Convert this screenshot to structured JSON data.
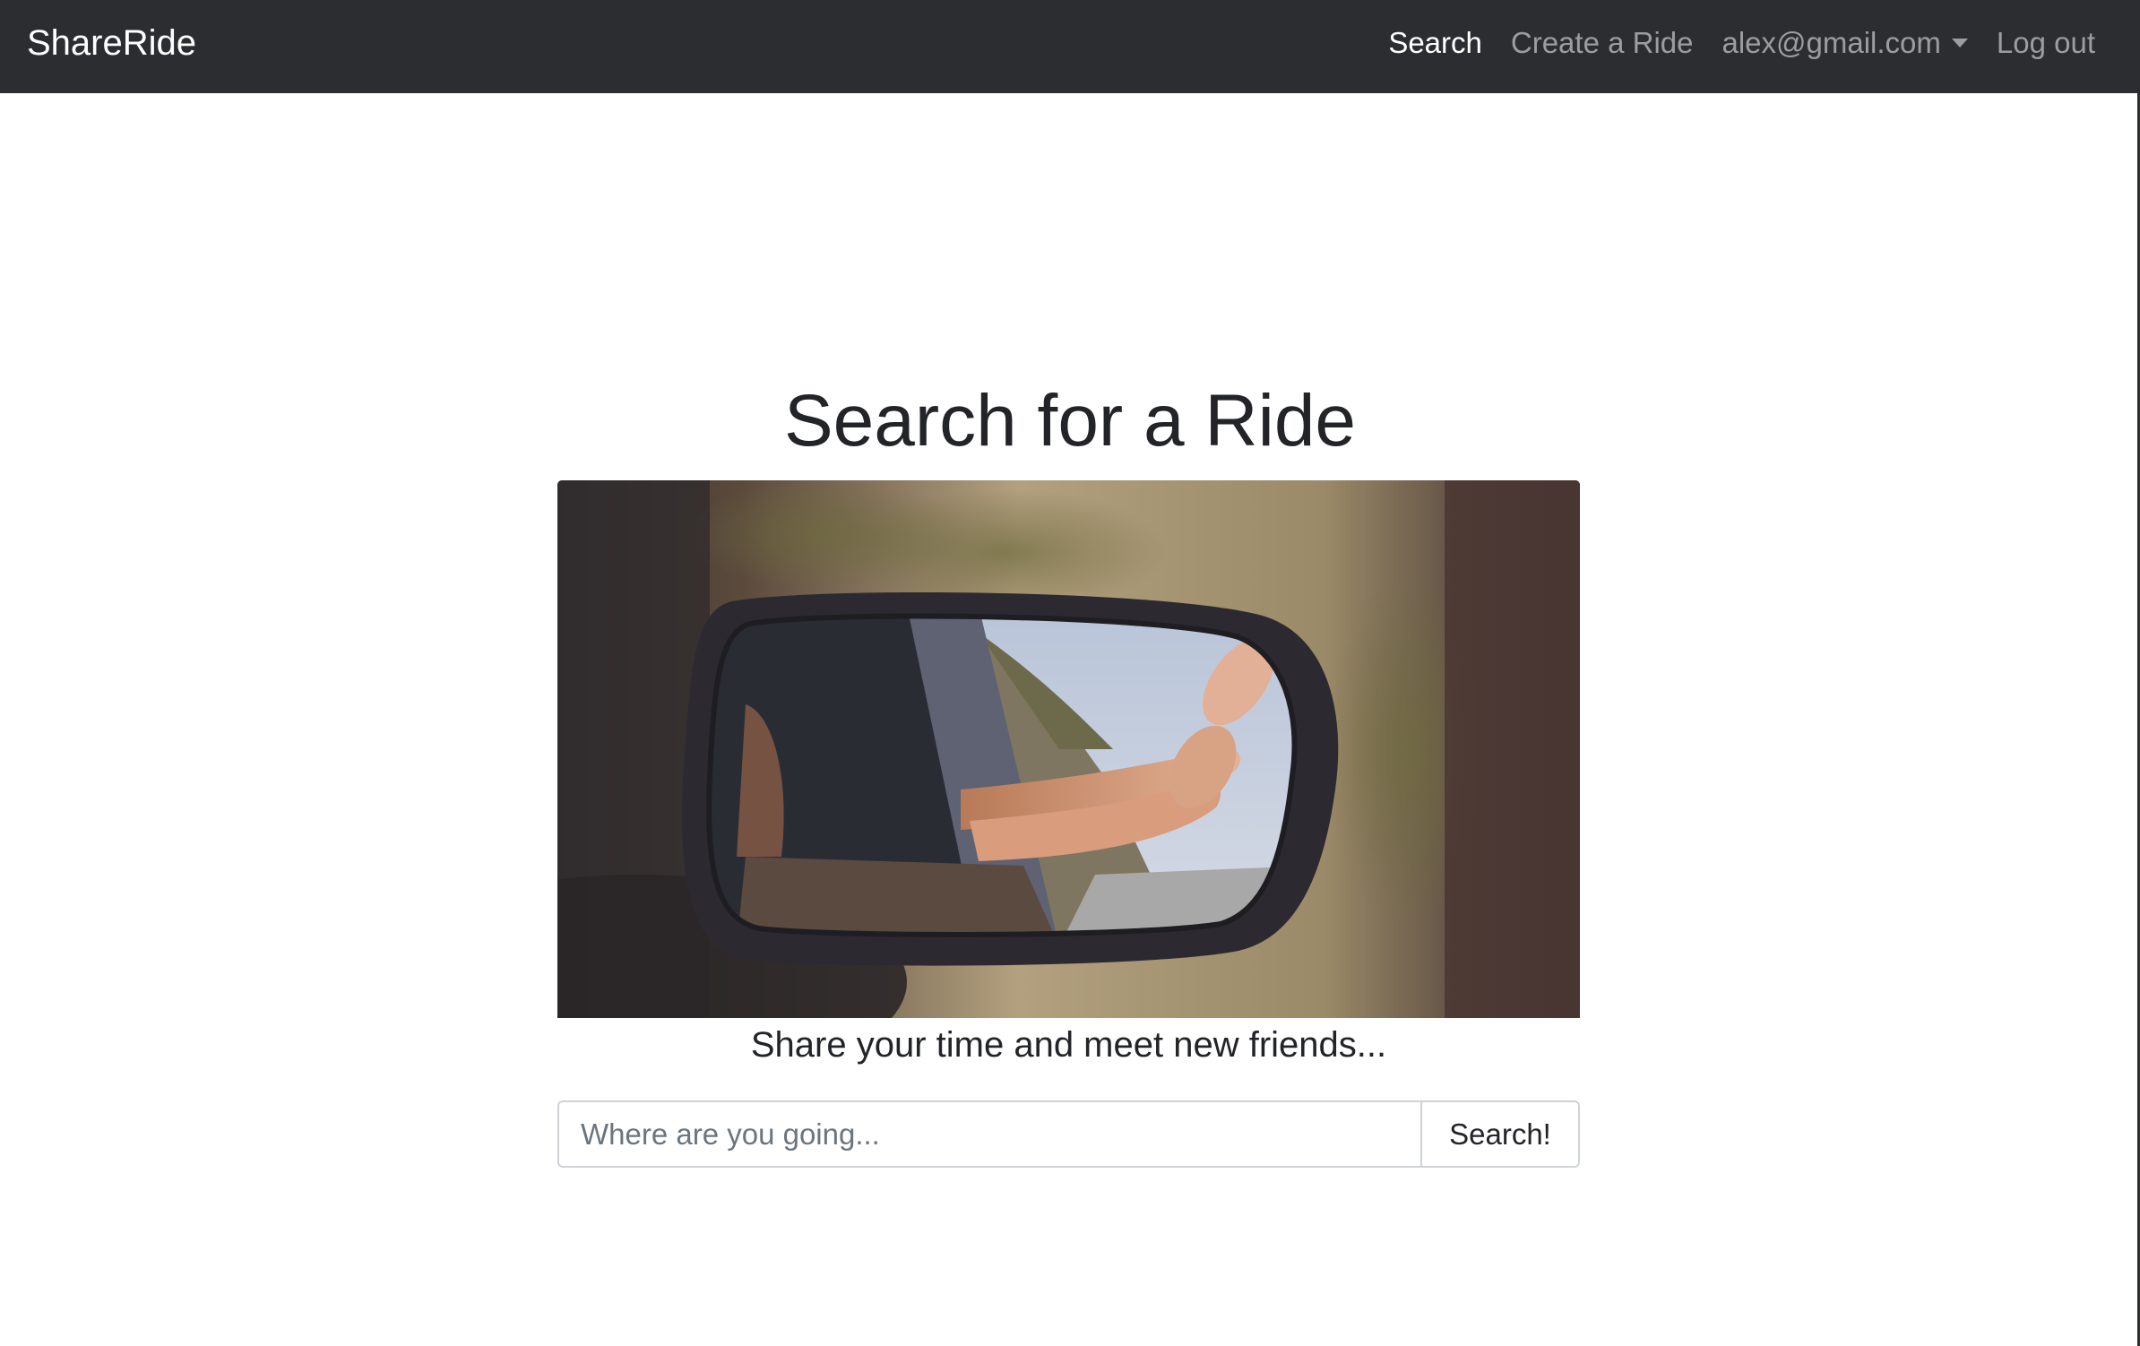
{
  "navbar": {
    "brand": "ShareRide",
    "links": {
      "search": "Search",
      "create": "Create a Ride",
      "account": "alex@gmail.com",
      "logout": "Log out"
    }
  },
  "main": {
    "title": "Search for a Ride",
    "tagline": "Share your time and meet new friends...",
    "search": {
      "placeholder": "Where are you going...",
      "value": "",
      "button_label": "Search!"
    }
  },
  "colors": {
    "navbar_bg": "#2b2d30",
    "nav_active": "#ffffff",
    "nav_inactive": "#9b9d9f"
  },
  "icons": {
    "account_dropdown": "caret-down-icon"
  }
}
